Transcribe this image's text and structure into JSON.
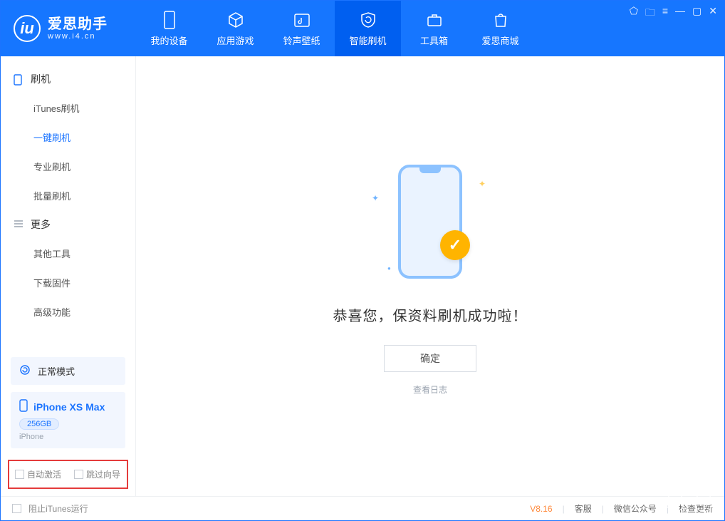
{
  "app": {
    "name": "爱思助手",
    "url": "www.i4.cn"
  },
  "nav": {
    "items": [
      {
        "label": "我的设备"
      },
      {
        "label": "应用游戏"
      },
      {
        "label": "铃声壁纸"
      },
      {
        "label": "智能刷机"
      },
      {
        "label": "工具箱"
      },
      {
        "label": "爱思商城"
      }
    ]
  },
  "sidebar": {
    "group1": {
      "title": "刷机",
      "items": [
        {
          "label": "iTunes刷机"
        },
        {
          "label": "一键刷机"
        },
        {
          "label": "专业刷机"
        },
        {
          "label": "批量刷机"
        }
      ]
    },
    "group2": {
      "title": "更多",
      "items": [
        {
          "label": "其他工具"
        },
        {
          "label": "下载固件"
        },
        {
          "label": "高级功能"
        }
      ]
    }
  },
  "device": {
    "mode": "正常模式",
    "name": "iPhone XS Max",
    "storage": "256GB",
    "type": "iPhone"
  },
  "options": {
    "auto_activate": "自动激活",
    "skip_wizard": "跳过向导"
  },
  "main": {
    "success": "恭喜您，保资料刷机成功啦！",
    "ok": "确定",
    "log": "查看日志"
  },
  "footer": {
    "block_itunes": "阻止iTunes运行",
    "version": "V8.16",
    "links": {
      "kefu": "客服",
      "wechat": "微信公众号",
      "update": "检查更新"
    }
  }
}
